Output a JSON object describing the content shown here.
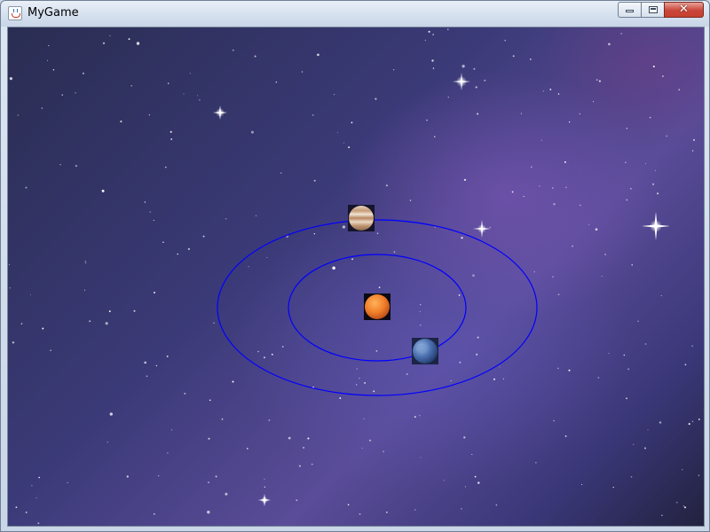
{
  "window": {
    "title": "MyGame",
    "app_icon": "java-cup-icon",
    "controls": {
      "minimize_icon": "minimize-icon",
      "maximize_icon": "maximize-icon",
      "close_glyph": "✕"
    }
  },
  "scene": {
    "background": "starfield-nebula",
    "orbit_color": "#0000ff",
    "orbits": [
      {
        "name": "inner-orbit"
      },
      {
        "name": "outer-orbit"
      }
    ],
    "bodies": [
      {
        "name": "sun",
        "color": "#f07f2a"
      },
      {
        "name": "earth",
        "color": "#4a6fb0"
      },
      {
        "name": "jupiter",
        "color": "#c9a27f"
      }
    ]
  }
}
